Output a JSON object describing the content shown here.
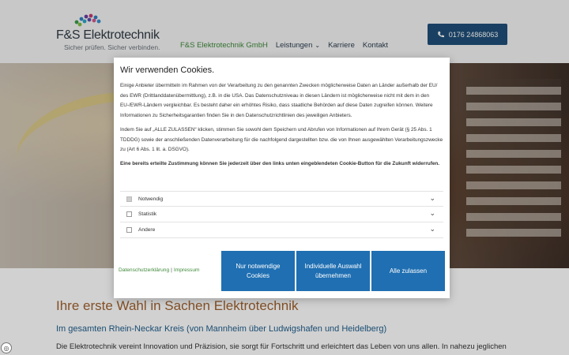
{
  "header": {
    "logo_name": "F&S Elektrotechnik",
    "logo_tagline": "Sicher prüfen. Sicher verbinden.",
    "nav": [
      {
        "label": "F&S Elektrotechnik GmbH"
      },
      {
        "label": "Leistungen"
      },
      {
        "label": "Karriere"
      },
      {
        "label": "Kontakt"
      }
    ],
    "phone": "0176 24868063"
  },
  "content": {
    "heading": "Ihre erste Wahl in Sachen Elektrotechnik",
    "subheading": "Im gesamten Rhein-Neckar Kreis (von Mannheim über Ludwigshafen und Heidelberg)",
    "paragraph": "Die Elektrotechnik vereint Innovation und Präzision, sie sorgt für Fortschritt und erleichtert das Leben von uns allen. In nahezu jeglichen"
  },
  "cookie_modal": {
    "title": "Wir verwenden Cookies.",
    "para1": "Einige Anbieter übermitteln im Rahmen von der Verarbeitung zu den genannten Zwecken möglicherweise Daten an Länder außerhalb der EU/ des EWR (Drittlanddatenübermittlung), z.B. in die USA. Das Datenschutzniveau in diesen Ländern ist möglicherweise nicht mit dem in den EU-/EWR-Ländern vergleichbar. Es besteht daher ein erhöhtes Risiko, dass staatliche Behörden auf diese Daten zugreifen können. Weitere Informationen zu Sicherheitsgarantien finden Sie in den Datenschutzrichtlinien des jeweiligen Anbieters.",
    "para2": "Indem Sie auf „ALLE ZULASSEN“ klicken, stimmen Sie sowohl dem Speichern und Abrufen von Informationen auf Ihrem Gerät (§ 25 Abs. 1 TDDDG) sowie der anschließenden Datenverarbeitung für die nachfolgend dargestellten bzw. die von Ihnen ausgewählten Verarbeitungszwecke zu (Art 6 Abs. 1 lit. a. DSGVO).",
    "para3": "Eine bereits erteilte Zustimmung können Sie jederzeit über den links unten eingeblendeten Cookie-Button für die Zukunft widerrufen.",
    "categories": [
      {
        "label": "Notwendig",
        "checked": true
      },
      {
        "label": "Statistik",
        "checked": false
      },
      {
        "label": "Andere",
        "checked": false
      }
    ],
    "privacy_link": "Datenschutzerklärung",
    "separator": "|",
    "imprint_link": "Impressum",
    "btn_necessary": "Nur notwendige Cookies",
    "btn_individual": "Individuelle Auswahl übernehmen",
    "btn_all": "Alle zulassen"
  },
  "colors": {
    "primary_button": "#1f6fb2",
    "phone_button": "#1f4f78",
    "link_green": "#3f8a3a",
    "heading_brown": "#a0622f",
    "subheading_blue": "#1f5e8c"
  },
  "icons": {
    "phone": "phone-icon",
    "chevron": "chevron-down-icon",
    "cookie": "cookie-settings-icon"
  }
}
